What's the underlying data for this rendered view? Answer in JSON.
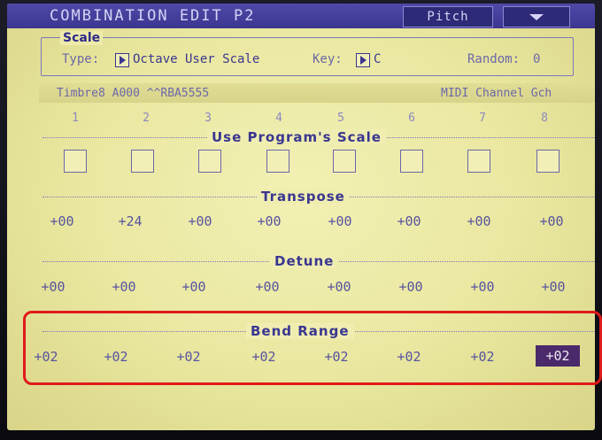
{
  "header": {
    "title": "COMBINATION EDIT P2",
    "page_button": "Pitch",
    "menu": "menu-icon"
  },
  "scale": {
    "legend": "Scale",
    "type_label": "Type:",
    "type_value": "Octave User Scale",
    "key_label": "Key:",
    "key_value": "C",
    "random_label": "Random:",
    "random_value": "0"
  },
  "timbre": {
    "name": "Timbre8 A000 ^^RBA5555",
    "midi": "MIDI Channel Gch"
  },
  "columns": [
    "1",
    "2",
    "3",
    "4",
    "5",
    "6",
    "7",
    "8"
  ],
  "use_scale": {
    "label": "Use Program's Scale",
    "checked": [
      false,
      false,
      false,
      false,
      false,
      false,
      false,
      false
    ]
  },
  "transpose": {
    "label": "Transpose",
    "values": [
      "+00",
      "+24",
      "+00",
      "+00",
      "+00",
      "+00",
      "+00",
      "+00"
    ]
  },
  "detune": {
    "label": "Detune",
    "values": [
      "+00",
      "+00",
      "+00",
      "+00",
      "+00",
      "+00",
      "+00",
      "+00"
    ]
  },
  "bend_range": {
    "label": "Bend Range",
    "values": [
      "+02",
      "+02",
      "+02",
      "+02",
      "+02",
      "+02",
      "+02",
      "+02"
    ],
    "selected_index": 7
  },
  "colors": {
    "title_bar": "#4f4aa8",
    "lcd": "#ecea a4",
    "text": "#3a3690",
    "selected_cell": "#4a2a6a",
    "highlight": "#e01a1a"
  }
}
